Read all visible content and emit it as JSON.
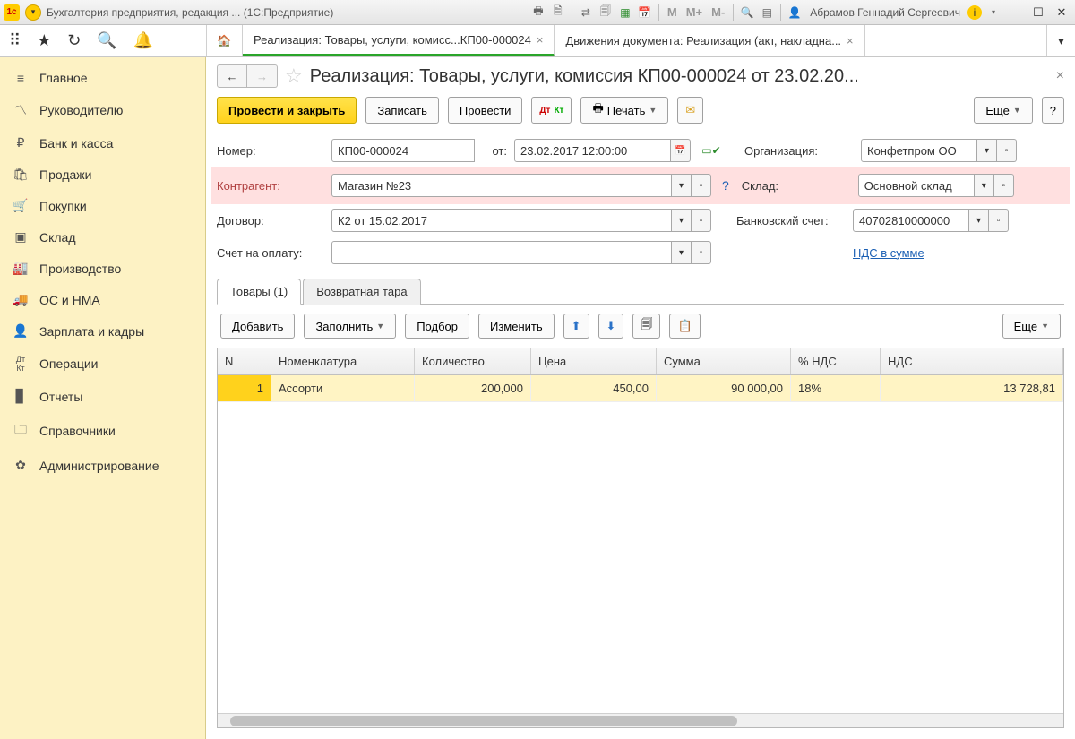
{
  "titlebar": {
    "title": "Бухгалтерия предприятия, редакция ... (1С:Предприятие)",
    "user": "Абрамов Геннадий Сергеевич",
    "m": "M",
    "m_plus": "M+",
    "m_minus": "M-"
  },
  "tabs": {
    "active": "Реализация: Товары, услуги, комисс...КП00-000024",
    "inactive": "Движения документа: Реализация (акт, накладна..."
  },
  "sidebar": [
    "Главное",
    "Руководителю",
    "Банк и касса",
    "Продажи",
    "Покупки",
    "Склад",
    "Производство",
    "ОС и НМА",
    "Зарплата и кадры",
    "Операции",
    "Отчеты",
    "Справочники",
    "Администрирование"
  ],
  "doc": {
    "title": "Реализация: Товары, услуги, комиссия КП00-000024 от 23.02.20..."
  },
  "toolbar": {
    "post_close": "Провести и закрыть",
    "write": "Записать",
    "post": "Провести",
    "print": "Печать",
    "more": "Еще",
    "help": "?"
  },
  "form": {
    "number_label": "Номер:",
    "number": "КП00-000024",
    "date_label": "от:",
    "date": "23.02.2017 12:00:00",
    "org_label": "Организация:",
    "org": "Конфетпром ОО",
    "contragent_label": "Контрагент:",
    "contragent": "Магазин №23",
    "warehouse_label": "Склад:",
    "warehouse": "Основной склад",
    "contract_label": "Договор:",
    "contract": "К2 от 15.02.2017",
    "bank_label": "Банковский счет:",
    "bank": "40702810000000",
    "invoice_label": "Счет на оплату:",
    "vat_link": "НДС в сумме"
  },
  "dtabs": {
    "goods": "Товары (1)",
    "tare": "Возвратная тара"
  },
  "ttb": {
    "add": "Добавить",
    "fill": "Заполнить",
    "select": "Подбор",
    "edit": "Изменить",
    "more": "Еще"
  },
  "table": {
    "headers": {
      "n": "N",
      "nom": "Номенклатура",
      "qty": "Количество",
      "price": "Цена",
      "sum": "Сумма",
      "vatp": "% НДС",
      "vat": "НДС"
    },
    "rows": [
      {
        "n": "1",
        "nom": "Ассорти",
        "qty": "200,000",
        "price": "450,00",
        "sum": "90 000,00",
        "vatp": "18%",
        "vat": "13 728,81"
      }
    ]
  }
}
